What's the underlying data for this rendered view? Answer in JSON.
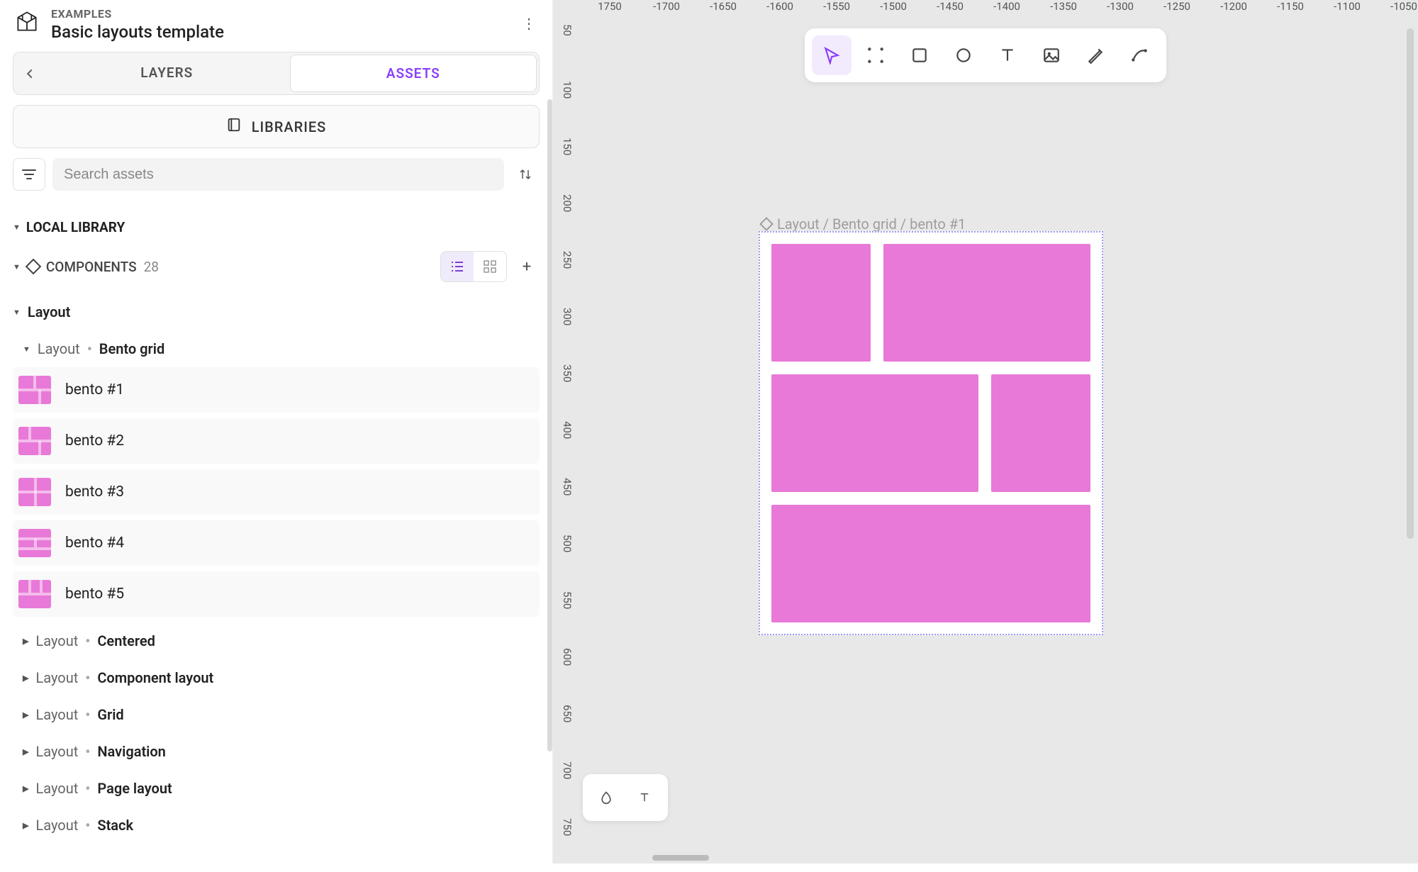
{
  "header": {
    "category": "EXAMPLES",
    "title": "Basic layouts template"
  },
  "tabs": {
    "layers": "LAYERS",
    "assets": "ASSETS"
  },
  "libraries_btn": "LIBRARIES",
  "search": {
    "placeholder": "Search assets"
  },
  "sections": {
    "local_library": "LOCAL LIBRARY",
    "components": "COMPONENTS",
    "components_count": "28"
  },
  "layout_root": "Layout",
  "groups": {
    "bento": {
      "prefix": "Layout",
      "name": "Bento grid"
    },
    "centered": {
      "prefix": "Layout",
      "name": "Centered"
    },
    "component_layout": {
      "prefix": "Layout",
      "name": "Component layout"
    },
    "grid": {
      "prefix": "Layout",
      "name": "Grid"
    },
    "navigation": {
      "prefix": "Layout",
      "name": "Navigation"
    },
    "page_layout": {
      "prefix": "Layout",
      "name": "Page layout"
    },
    "stack": {
      "prefix": "Layout",
      "name": "Stack"
    }
  },
  "bento_items": [
    "bento #1",
    "bento #2",
    "bento #3",
    "bento #4",
    "bento #5"
  ],
  "canvas": {
    "breadcrumb": "Layout / Bento grid / bento #1",
    "ruler_top": [
      "1750",
      "-1700",
      "-1650",
      "-1600",
      "-1550",
      "-1500",
      "-1450",
      "-1400",
      "-1350",
      "-1300",
      "-1250",
      "-1200",
      "-1150",
      "-1100",
      "-1050"
    ],
    "ruler_left": [
      "50",
      "100",
      "150",
      "200",
      "250",
      "300",
      "350",
      "400",
      "450",
      "500",
      "550",
      "600",
      "650",
      "700",
      "750"
    ]
  }
}
